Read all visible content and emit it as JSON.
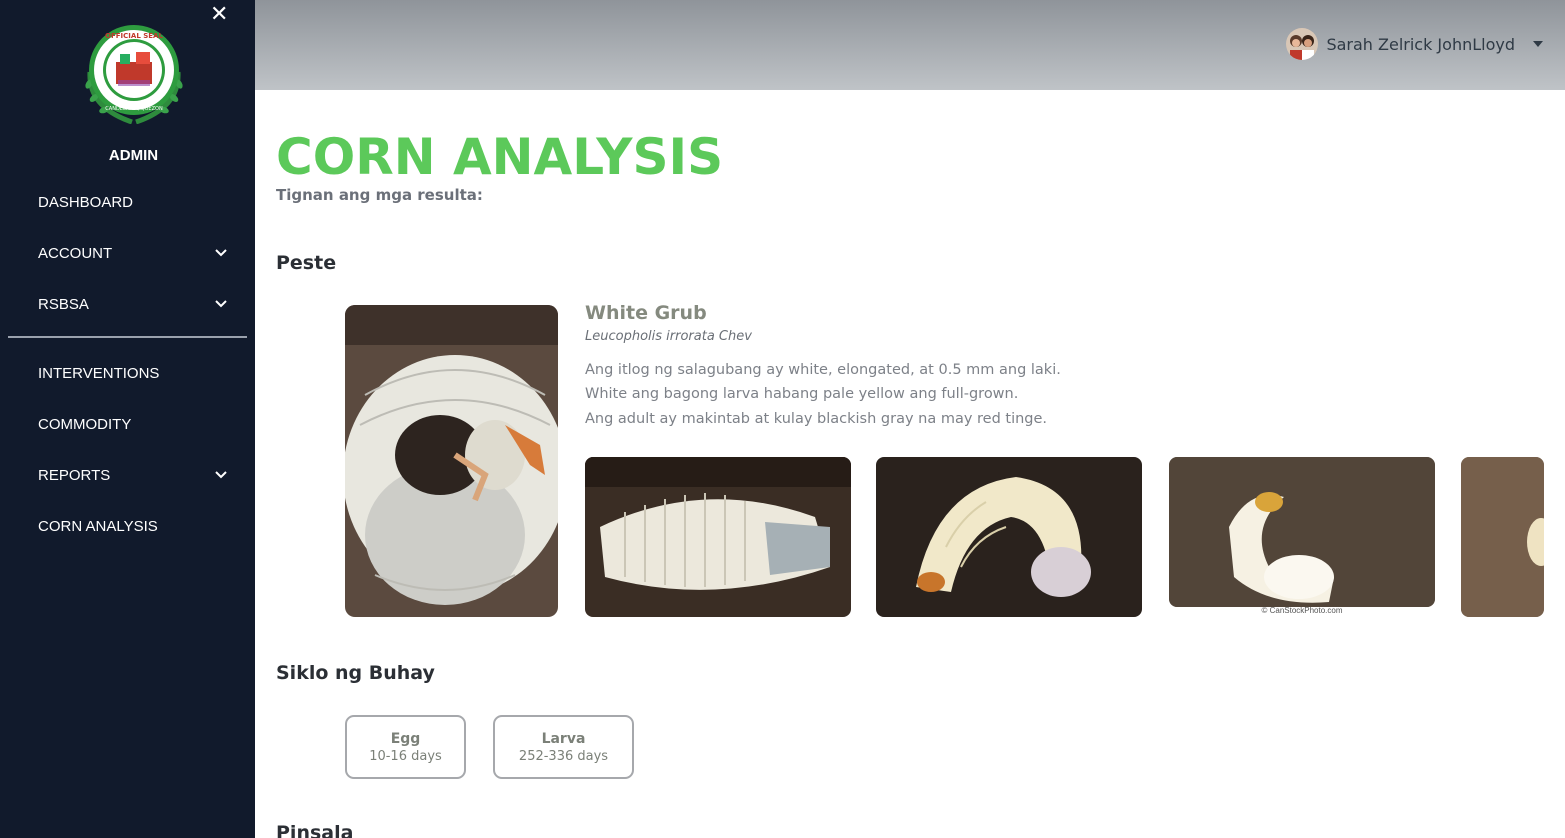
{
  "sidebar": {
    "close_icon": "close-icon",
    "logo": {
      "lines": [
        "OFFICIAL SEAL",
        "CANDELARIA, QUEZON"
      ],
      "colors": {
        "ring": "#2e9c3f",
        "accent": "#c0392b"
      }
    },
    "role": "ADMIN",
    "items": [
      {
        "label": "DASHBOARD",
        "has_dropdown": false
      },
      {
        "label": "ACCOUNT",
        "has_dropdown": true
      },
      {
        "label": "RSBSA",
        "has_dropdown": true
      },
      {
        "label": "INTERVENTIONS",
        "has_dropdown": false
      },
      {
        "label": "COMMODITY",
        "has_dropdown": false
      },
      {
        "label": "REPORTS",
        "has_dropdown": true
      },
      {
        "label": "CORN ANALYSIS",
        "has_dropdown": false
      }
    ]
  },
  "topbar": {
    "user_name": "Sarah Zelrick JohnLloyd",
    "dropdown_icon": "caret-down-icon"
  },
  "main": {
    "title": "CORN ANALYSIS",
    "subtitle": "Tignan ang mga resulta:",
    "pest_section": "Peste",
    "pest": {
      "name": "White Grub",
      "scientific_name": "Leucopholis irrorata Chev",
      "description": [
        "Ang itlog ng salagubang ay white, elongated, at 0.5 mm ang laki.",
        "White ang bagong larva habang pale yellow ang full-grown.",
        "Ang adult ay makintab at kulay blackish gray na may red tinge."
      ],
      "image_credit": "© CanStockPhoto.com"
    },
    "lifecycle_section": "Siklo ng Buhay",
    "lifecycle": [
      {
        "stage": "Egg",
        "duration": "10-16 days"
      },
      {
        "stage": "Larva",
        "duration": "252-336 days"
      }
    ],
    "next_section": "Pinsala"
  },
  "colors": {
    "sidebar_bg": "#111a2c",
    "title_green": "#5cc95a",
    "topbar_gradient": [
      "#8f949a",
      "#bfc3c7"
    ]
  }
}
